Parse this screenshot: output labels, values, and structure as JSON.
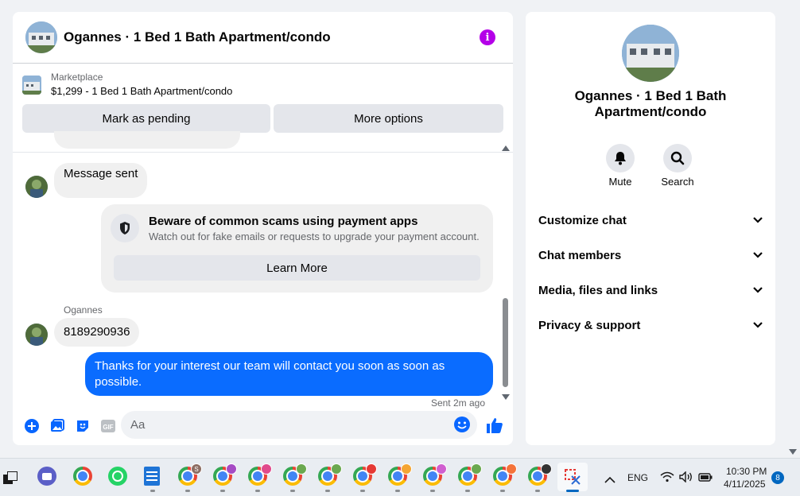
{
  "chat": {
    "title": "Ogannes · 1 Bed 1 Bath Apartment/condo",
    "listing": {
      "source": "Marketplace",
      "price_title": "$1,299 - 1 Bed 1 Bath Apartment/condo",
      "mark_pending_label": "Mark as pending",
      "more_options_label": "More options"
    },
    "messages": {
      "auto_sent": "Message sent",
      "scam_notice": {
        "title": "Beware of common scams using payment apps",
        "subtitle": "Watch out for fake emails or requests to upgrade your payment account.",
        "button_label": "Learn More"
      },
      "sender_name": "Ogannes",
      "incoming_text": "8189290936",
      "outgoing_text": "Thanks for your interest our team will contact you soon as soon as possible.",
      "status": "Sent 2m ago"
    },
    "composer": {
      "placeholder": "Aa"
    }
  },
  "info_panel": {
    "name": "Ogannes · 1 Bed 1 Bath Apartment/condo",
    "actions": [
      {
        "label": "Mute",
        "icon": "bell-icon"
      },
      {
        "label": "Search",
        "icon": "search-icon"
      }
    ],
    "sections": [
      {
        "label": "Customize chat"
      },
      {
        "label": "Chat members"
      },
      {
        "label": "Media, files and links"
      },
      {
        "label": "Privacy & support"
      }
    ]
  },
  "taskbar": {
    "language": "ENG",
    "time": "10:30 PM",
    "date": "4/11/2025",
    "notification_count": "8",
    "profile_badge": "S"
  },
  "colors": {
    "accent_blue": "#0a6cff",
    "info_purple": "#b400e8",
    "messenger_blue": "#0866ff"
  }
}
